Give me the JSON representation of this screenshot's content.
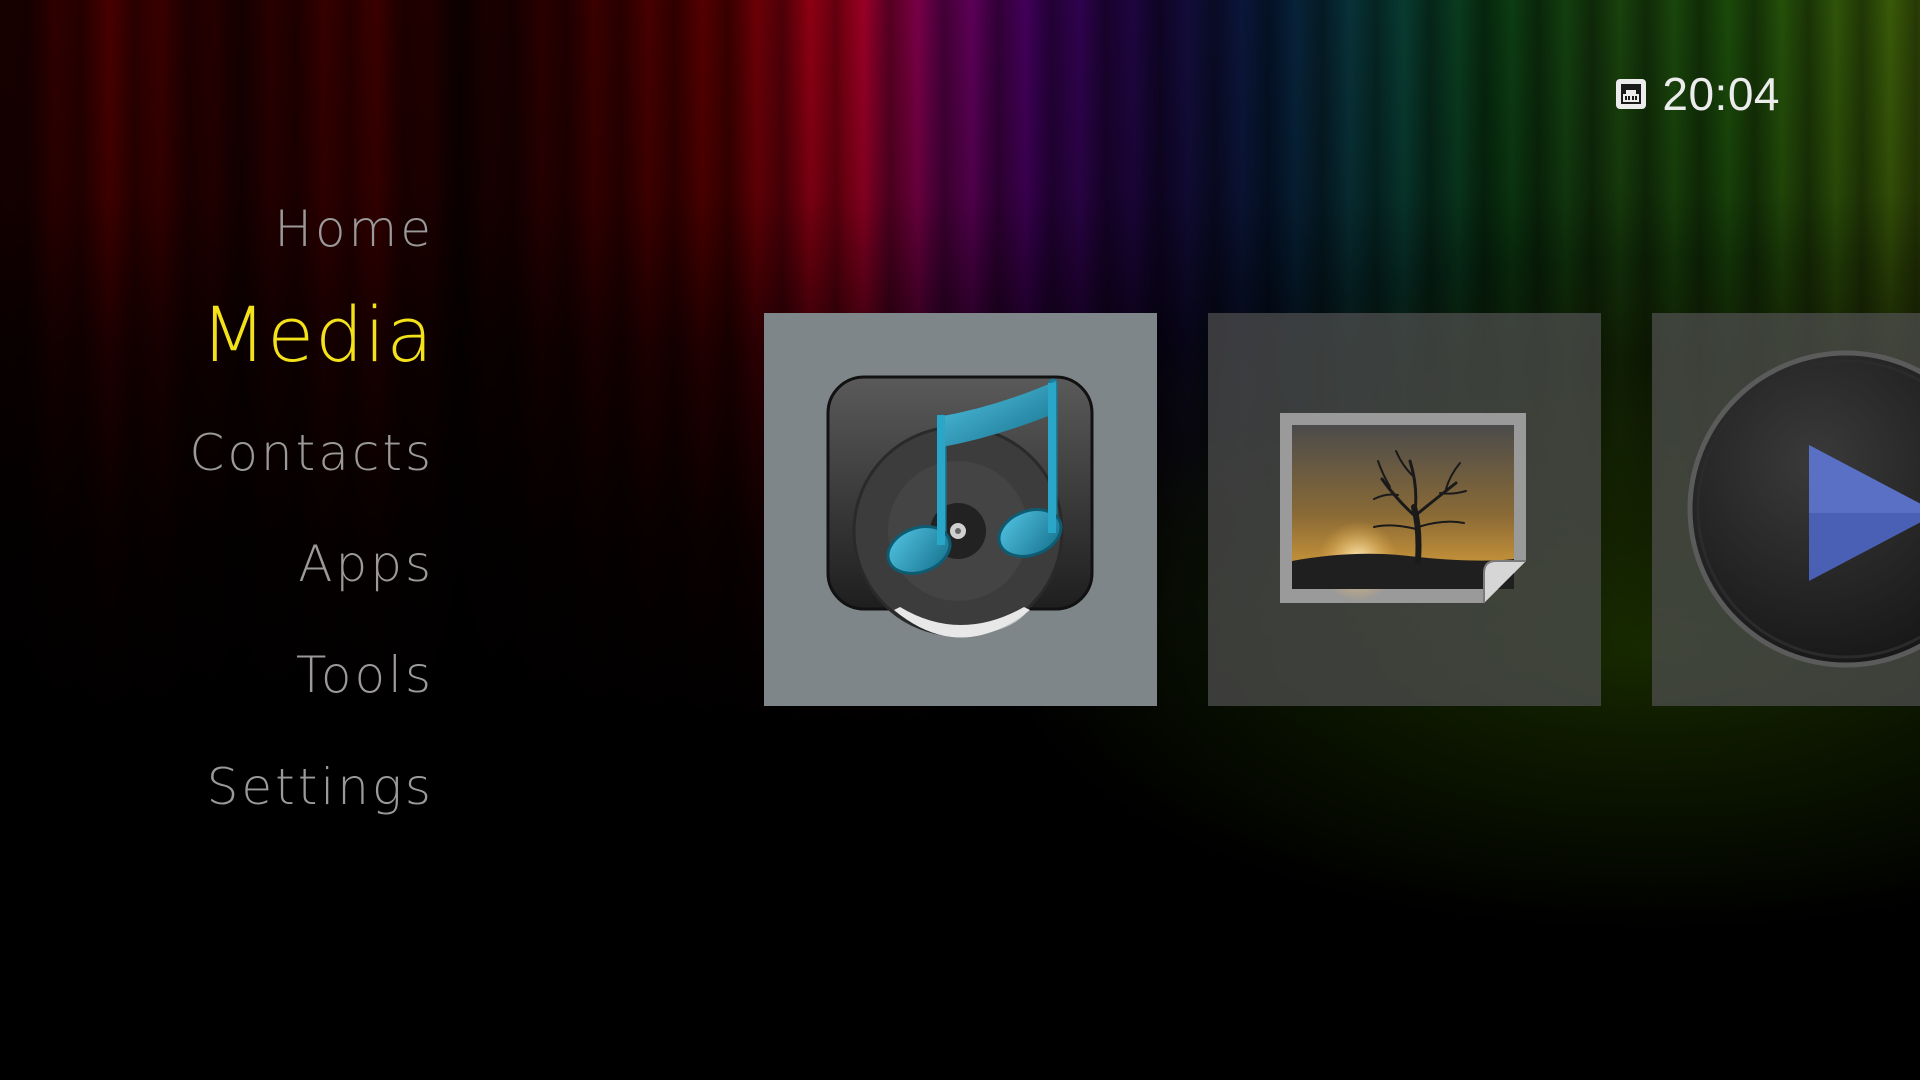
{
  "status": {
    "network_icon": "ethernet-icon",
    "time": "20:04"
  },
  "nav": {
    "items": [
      {
        "label": "Home"
      },
      {
        "label": "Media",
        "active": true
      },
      {
        "label": "Contacts"
      },
      {
        "label": "Apps"
      },
      {
        "label": "Tools"
      },
      {
        "label": "Settings"
      }
    ]
  },
  "tiles": [
    {
      "icon": "music-note-disc-icon",
      "selected": true
    },
    {
      "icon": "landscape-picture-icon",
      "selected": false
    },
    {
      "icon": "play-circle-icon",
      "selected": false
    }
  ],
  "colors": {
    "active_menu": "#f3e21a",
    "inactive_menu": "#9a9a9a",
    "selected_tile": "#7f8689",
    "music_note": "#1f9bbd"
  }
}
